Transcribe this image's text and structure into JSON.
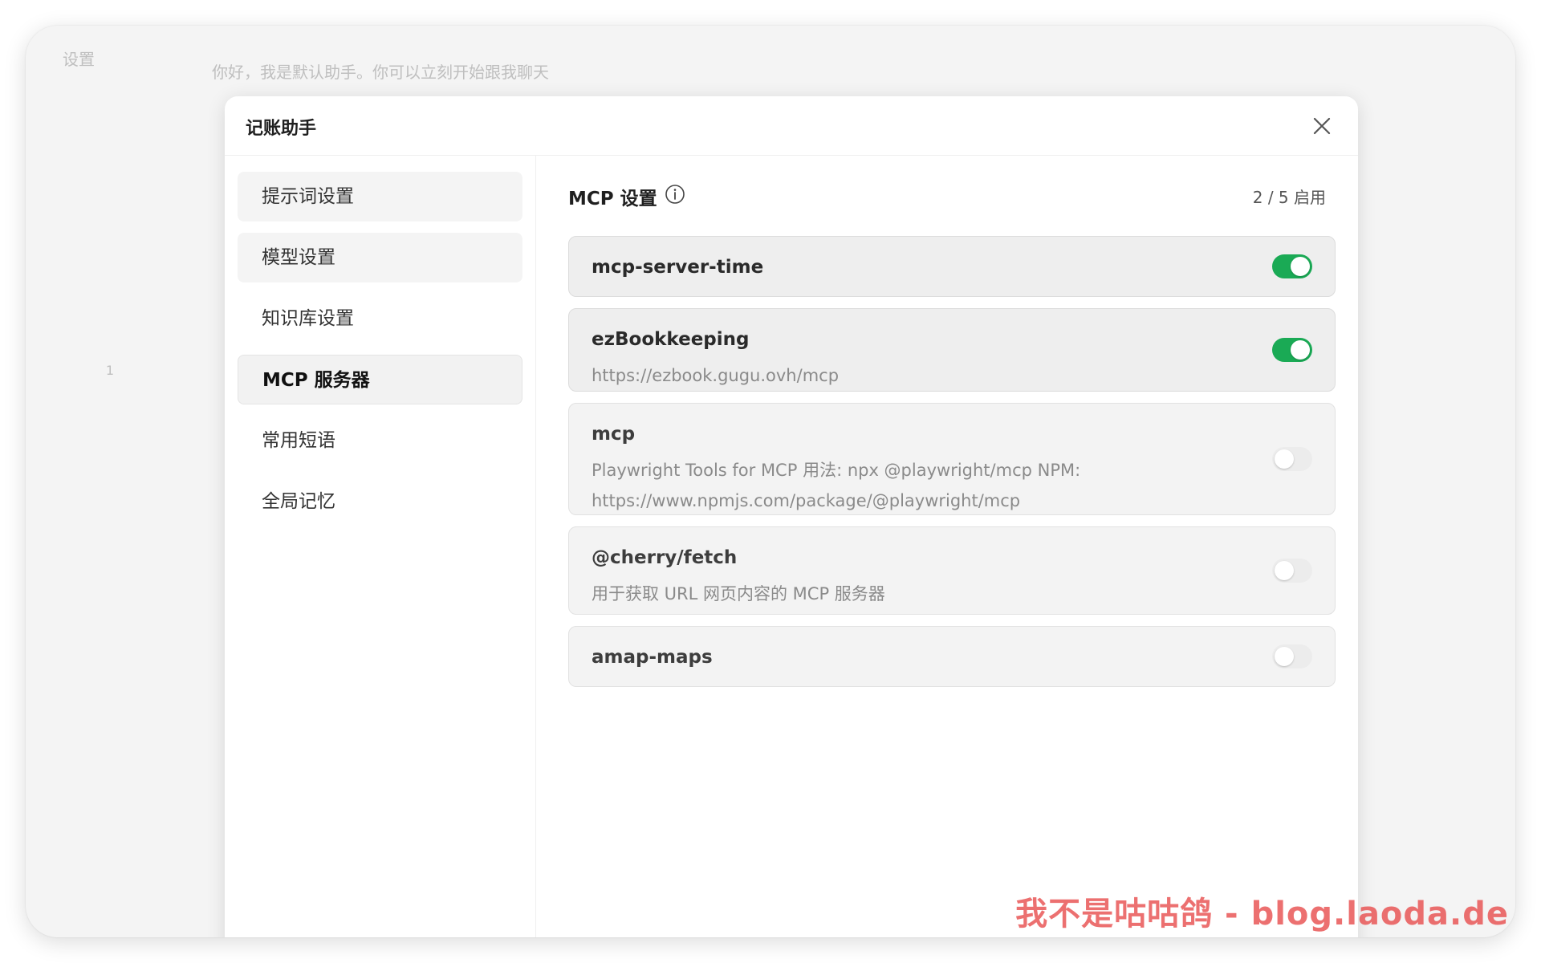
{
  "background": {
    "settings_label": "设置",
    "greeting": "你好，我是默认助手。你可以立刻开始跟我聊天",
    "badge_number": "1"
  },
  "modal": {
    "title": "记账助手",
    "close_icon": "close-icon"
  },
  "sidebar": {
    "items": [
      {
        "label": "提示词设置"
      },
      {
        "label": "模型设置"
      },
      {
        "label": "知识库设置"
      },
      {
        "label": "MCP 服务器"
      },
      {
        "label": "常用短语"
      },
      {
        "label": "全局记忆"
      }
    ],
    "active_index": 3
  },
  "mcp": {
    "title": "MCP 设置",
    "info_icon": "info-icon",
    "counter": "2 / 5 启用",
    "servers": [
      {
        "name": "mcp-server-time",
        "description": "",
        "enabled": true
      },
      {
        "name": "ezBookkeeping",
        "description": "https://ezbook.gugu.ovh/mcp",
        "enabled": true
      },
      {
        "name": "mcp",
        "description": "Playwright Tools for MCP 用法: npx @playwright/mcp NPM: https://www.npmjs.com/package/@playwright/mcp",
        "enabled": false
      },
      {
        "name": "@cherry/fetch",
        "description": "用于获取 URL 网页内容的 MCP 服务器",
        "enabled": false
      },
      {
        "name": "amap-maps",
        "description": "",
        "enabled": false
      }
    ]
  },
  "colors": {
    "toggle_on": "#1aaa55",
    "toggle_off": "#ececec"
  },
  "watermark": "我不是咕咕鸽 - blog.laoda.de"
}
